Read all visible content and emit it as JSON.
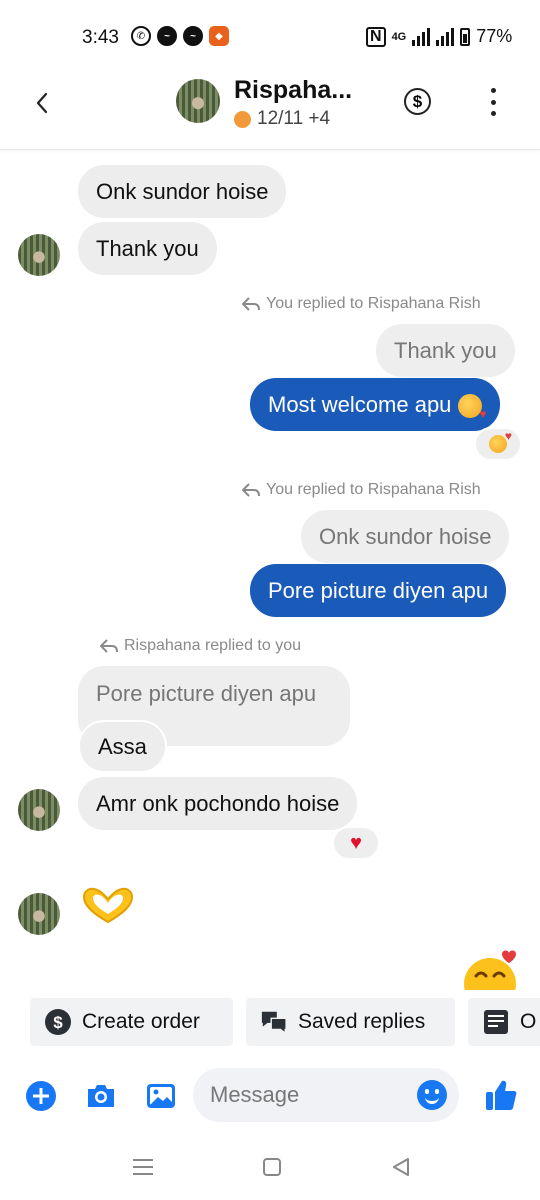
{
  "status_bar": {
    "time": "3:43",
    "network": "4G",
    "battery": "77%"
  },
  "header": {
    "contact_name": "Rispaha...",
    "subtitle": "12/11 +4",
    "status_color": "#f29a3a"
  },
  "messages": {
    "m1": "Onk sundor hoise",
    "m2": "Thank you",
    "reply_note_1": "You replied to Rispahana Rish",
    "quoted_1": "Thank you",
    "m3": "Most welcome apu",
    "reply_note_2": "You replied to Rispahana Rish",
    "quoted_2": "Onk sundor hoise",
    "m4": "Pore picture diyen apu",
    "reply_note_3": "Rispahana replied to you",
    "quoted_3": "Pore picture diyen apu",
    "m5": "Assa",
    "m6": "Amr onk pochondo hoise"
  },
  "quick_actions": {
    "create_order": "Create order",
    "saved_replies": "Saved replies",
    "third": "O"
  },
  "composer": {
    "placeholder": "Message"
  },
  "colors": {
    "accent": "#1877f2",
    "outgoing_bubble": "#1a5ab8",
    "incoming_bubble": "#ededed"
  }
}
